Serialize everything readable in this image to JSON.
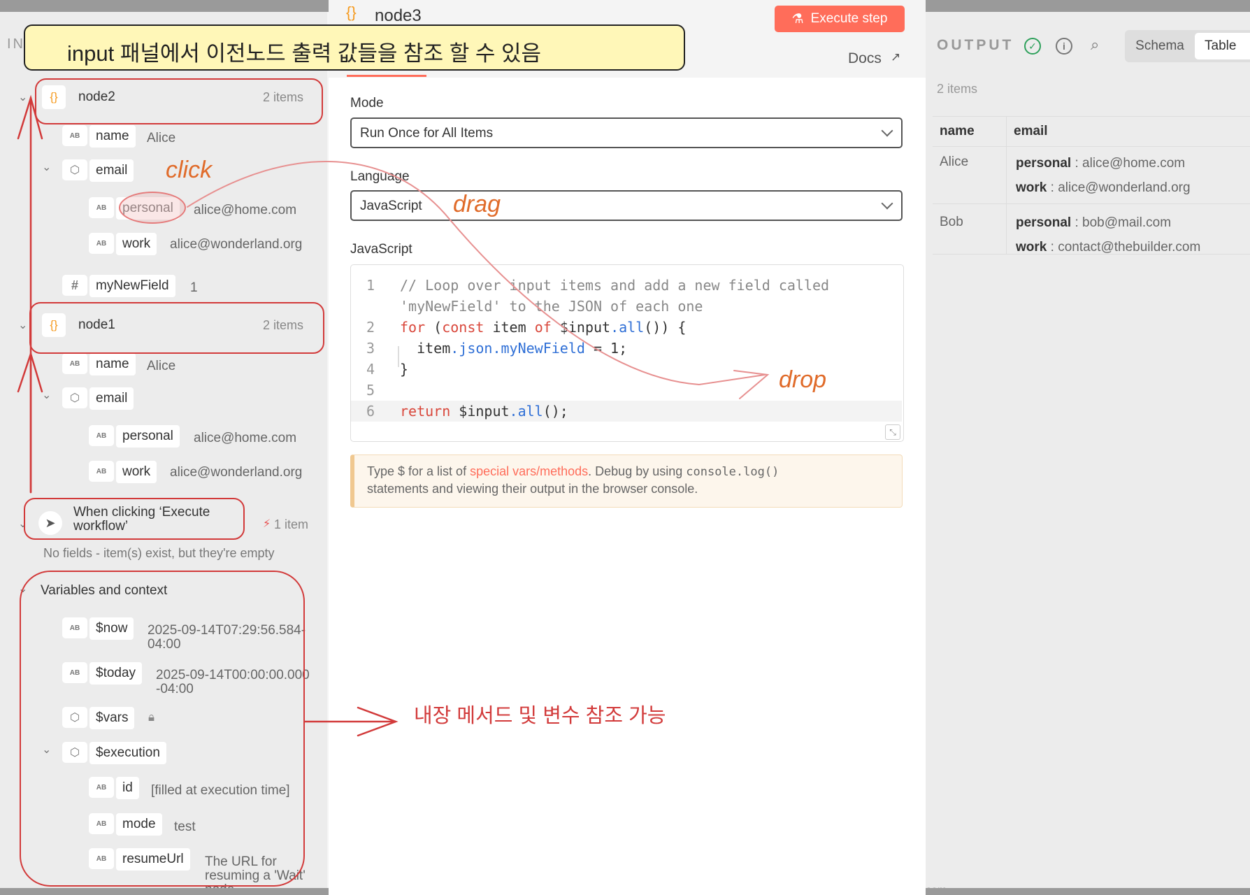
{
  "annotations": {
    "banner": "input 패널에서 이전노드 출력 값들을 참조 할 수 있음",
    "click": "click",
    "drag": "drag",
    "drop": "drop",
    "builtin": "내장 메서드 및 변수 참조 가능"
  },
  "input_panel": {
    "header_partial": "IN",
    "nodes": [
      {
        "title": "node2",
        "count": "2 items",
        "fields": {
          "name_key": "name",
          "name_val": "Alice",
          "email_key": "email",
          "personal_key": "personal",
          "personal_val": "alice@home.com",
          "work_key": "work",
          "work_val": "alice@wonderland.org",
          "extra_key": "myNewField",
          "extra_val": "1"
        }
      },
      {
        "title": "node1",
        "count": "2 items",
        "fields": {
          "name_key": "name",
          "name_val": "Alice",
          "email_key": "email",
          "personal_key": "personal",
          "personal_val": "alice@home.com",
          "work_key": "work",
          "work_val": "alice@wonderland.org"
        }
      }
    ],
    "trigger": {
      "title": "When clicking ‘Execute workflow’",
      "count": "1 item",
      "empty_note": "No fields - item(s) exist, but they're empty"
    },
    "context": {
      "title": "Variables and context",
      "now_key": "$now",
      "now_val": "2025-09-14T07:29:56.584-04:00",
      "today_key": "$today",
      "today_val": "2025-09-14T00:00:00.000-04:00",
      "vars_key": "$vars",
      "execution_key": "$execution",
      "id_key": "id",
      "id_val": "[filled at execution time]",
      "mode_key": "mode",
      "mode_val": "test",
      "resume_key": "resumeUrl",
      "resume_val": "The URL for resuming a 'Wait' node"
    },
    "type_badges": {
      "string": "AB",
      "number": "#"
    }
  },
  "editor": {
    "node_title": "node3",
    "execute_label": "Execute step",
    "docs_label": "Docs",
    "mode_label": "Mode",
    "mode_value": "Run Once for All Items",
    "language_label": "Language",
    "language_value": "JavaScript",
    "code_label": "JavaScript",
    "code_lines": [
      {
        "n": "1",
        "text": "// Loop over input items and add a new field called"
      },
      {
        "n": "",
        "text": "'myNewField' to the JSON of each one"
      },
      {
        "n": "2",
        "text": "for (const item of $input.all()) {"
      },
      {
        "n": "3",
        "text": "  item.json.myNewField = 1;"
      },
      {
        "n": "4",
        "text": "}"
      },
      {
        "n": "5",
        "text": ""
      },
      {
        "n": "6",
        "text": "return $input.all();"
      }
    ],
    "hint_prefix": "Type $ for a list of ",
    "hint_link": "special vars/methods",
    "hint_mid": ". Debug by using ",
    "hint_code": "console.log()",
    "hint_line2": "statements and viewing their output in the browser console."
  },
  "output_panel": {
    "title": "OUTPUT",
    "count": "2 items",
    "tabs": [
      "Schema",
      "Table"
    ],
    "columns": [
      "name",
      "email"
    ],
    "rows": [
      {
        "name": "Alice",
        "emails": [
          [
            "personal",
            "alice@home.com"
          ],
          [
            "work",
            "alice@wonderland.org"
          ]
        ]
      },
      {
        "name": "Bob",
        "emails": [
          [
            "personal",
            "bob@mail.com"
          ],
          [
            "work",
            "contact@thebuilder.com"
          ]
        ]
      }
    ],
    "footer_partial": "com"
  },
  "colors": {
    "accent": "#ff6d5a",
    "annotation_red": "#d23a3a",
    "annotation_orange": "#e06b2a",
    "banner_bg": "#fff7b8",
    "success": "#2fa15c"
  }
}
